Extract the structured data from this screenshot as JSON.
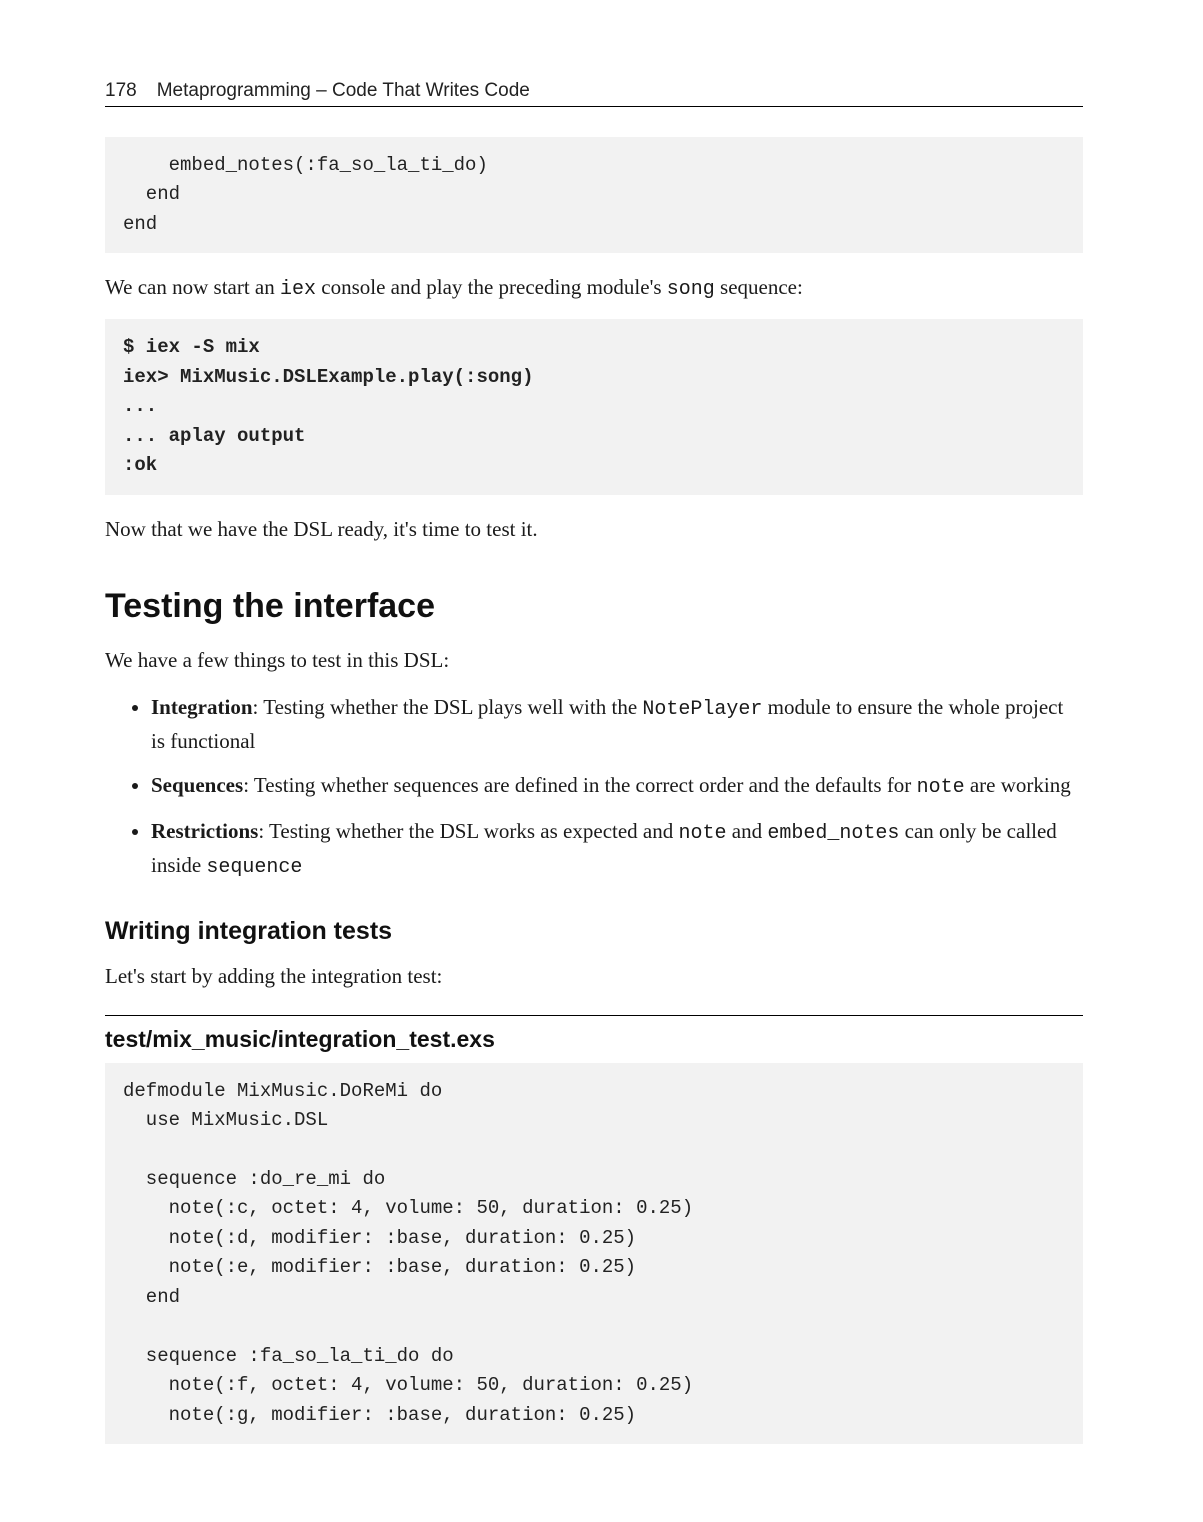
{
  "header": {
    "page_num": "178",
    "chapter": "Metaprogramming – Code That Writes Code"
  },
  "code1": "    embed_notes(:fa_so_la_ti_do)\n  end\nend",
  "para1_a": "We can now start an ",
  "para1_mono1": "iex",
  "para1_b": " console and play the preceding module's ",
  "para1_mono2": "song",
  "para1_c": " sequence:",
  "code2": "$ iex -S mix\niex> MixMusic.DSLExample.play(:song)\n...\n... aplay output\n:ok",
  "para2": "Now that we have the DSL ready, it's time to test it.",
  "h2": "Testing the interface",
  "para3": "We have a few things to test in this DSL:",
  "bullets": {
    "b1_strong": "Integration",
    "b1_a": ": Testing whether the DSL plays well with the ",
    "b1_mono": "NotePlayer",
    "b1_b": " module to ensure the whole project is functional",
    "b2_strong": "Sequences",
    "b2_a": ": Testing whether sequences are defined in the correct order and the defaults for ",
    "b2_mono": "note",
    "b2_b": " are working",
    "b3_strong": "Restrictions",
    "b3_a": ": Testing whether the DSL works as expected and ",
    "b3_mono1": "note",
    "b3_b": " and ",
    "b3_mono2": "embed_notes",
    "b3_c": " can only be called inside ",
    "b3_mono3": "sequence"
  },
  "h3": "Writing integration tests",
  "para4": "Let's start by adding the integration test:",
  "file_title": "test/mix_music/integration_test.exs",
  "code3": "defmodule MixMusic.DoReMi do\n  use MixMusic.DSL\n\n  sequence :do_re_mi do\n    note(:c, octet: 4, volume: 50, duration: 0.25)\n    note(:d, modifier: :base, duration: 0.25)\n    note(:e, modifier: :base, duration: 0.25)\n  end\n\n  sequence :fa_so_la_ti_do do\n    note(:f, octet: 4, volume: 50, duration: 0.25)\n    note(:g, modifier: :base, duration: 0.25)"
}
